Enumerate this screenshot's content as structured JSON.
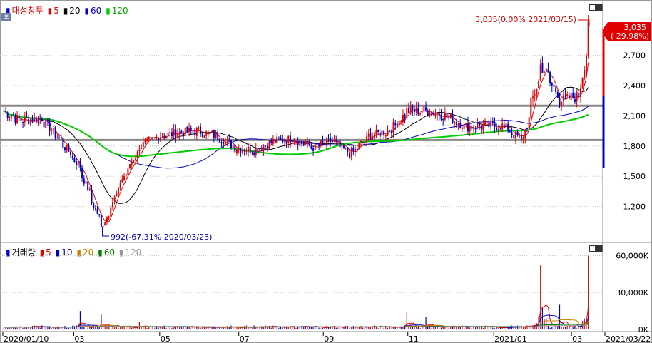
{
  "price_legend": {
    "name": "대성창투",
    "ma": [
      {
        "label": "5",
        "color": "#e00000"
      },
      {
        "label": "20",
        "color": "#000000"
      },
      {
        "label": "60",
        "color": "#0000c0"
      },
      {
        "label": "120",
        "color": "#00cc00"
      }
    ]
  },
  "volume_legend": {
    "name": "거래량",
    "ma": [
      {
        "label": "5",
        "color": "#e00000"
      },
      {
        "label": "10",
        "color": "#0000c0"
      },
      {
        "label": "20",
        "color": "#d08000"
      },
      {
        "label": "60",
        "color": "#008000"
      },
      {
        "label": "120",
        "color": "#999999"
      }
    ]
  },
  "annotations": {
    "high": "3,035(0.00% 2021/03/15)",
    "low": "992(-67.31% 2020/03/23)",
    "last_price": "3,035",
    "last_change": "( 29.98%)"
  },
  "corner_label": "호",
  "colors": {
    "up": "#e00000",
    "down": "#0000c0",
    "ma5": "#e00000",
    "ma20": "#000000",
    "ma60": "#0000c0",
    "ma120": "#00cc00",
    "support_lines": "#888888"
  },
  "chart_data": [
    {
      "type": "candlestick",
      "title": "대성창투",
      "y_ticks": [
        "2,700",
        "2,400",
        "2,100",
        "1,800",
        "1,500",
        "1,200"
      ],
      "y_tick_values": [
        2700,
        2400,
        2100,
        1800,
        1500,
        1200
      ],
      "ylim": [
        900,
        3150
      ],
      "x_ticks": [
        "2020/01/10",
        "03",
        "05",
        "07",
        "09",
        "11",
        "2021/01",
        "03",
        "2021/03/22"
      ],
      "horizontal_lines": [
        2200,
        1860
      ],
      "high": {
        "value": 3035,
        "date": "2021/03/15"
      },
      "low": {
        "value": 992,
        "date": "2020/03/23"
      },
      "last": 3035,
      "close_series_approx": [
        {
          "x": "2020/01/10",
          "y": 2150
        },
        {
          "x": "2020/01/24",
          "y": 2050
        },
        {
          "x": "2020/02/07",
          "y": 2080
        },
        {
          "x": "2020/02/21",
          "y": 1860
        },
        {
          "x": "2020/03/06",
          "y": 1600
        },
        {
          "x": "2020/03/23",
          "y": 992
        },
        {
          "x": "2020/04/06",
          "y": 1450
        },
        {
          "x": "2020/04/20",
          "y": 1800
        },
        {
          "x": "2020/05/04",
          "y": 1900
        },
        {
          "x": "2020/05/18",
          "y": 1930
        },
        {
          "x": "2020/06/01",
          "y": 1950
        },
        {
          "x": "2020/06/15",
          "y": 1900
        },
        {
          "x": "2020/06/29",
          "y": 1780
        },
        {
          "x": "2020/07/13",
          "y": 1760
        },
        {
          "x": "2020/07/27",
          "y": 1850
        },
        {
          "x": "2020/08/10",
          "y": 1870
        },
        {
          "x": "2020/08/24",
          "y": 1780
        },
        {
          "x": "2020/09/07",
          "y": 1850
        },
        {
          "x": "2020/09/21",
          "y": 1720
        },
        {
          "x": "2020/10/05",
          "y": 1900
        },
        {
          "x": "2020/10/19",
          "y": 1950
        },
        {
          "x": "2020/11/02",
          "y": 2150
        },
        {
          "x": "2020/11/16",
          "y": 2150
        },
        {
          "x": "2020/11/30",
          "y": 2100
        },
        {
          "x": "2020/12/14",
          "y": 1990
        },
        {
          "x": "2020/12/28",
          "y": 2000
        },
        {
          "x": "2021/01/11",
          "y": 2000
        },
        {
          "x": "2021/01/25",
          "y": 1850
        },
        {
          "x": "2021/02/08",
          "y": 2600
        },
        {
          "x": "2021/02/22",
          "y": 2250
        },
        {
          "x": "2021/03/08",
          "y": 2300
        },
        {
          "x": "2021/03/15",
          "y": 3035
        }
      ]
    },
    {
      "type": "bar",
      "title": "거래량",
      "y_ticks": [
        "60,000K",
        "30,000K",
        "0K"
      ],
      "y_tick_values": [
        60000,
        30000,
        0
      ],
      "ylim": [
        0,
        62000
      ],
      "volume_series_approx": [
        {
          "x": "2020/03/06",
          "y": 15000
        },
        {
          "x": "2020/03/23",
          "y": 12000
        },
        {
          "x": "2020/04/20",
          "y": 6000
        },
        {
          "x": "2020/11/02",
          "y": 14000
        },
        {
          "x": "2020/11/16",
          "y": 10000
        },
        {
          "x": "2021/02/08",
          "y": 52000
        },
        {
          "x": "2021/02/22",
          "y": 20000
        },
        {
          "x": "2021/03/15",
          "y": 60000
        }
      ]
    }
  ]
}
